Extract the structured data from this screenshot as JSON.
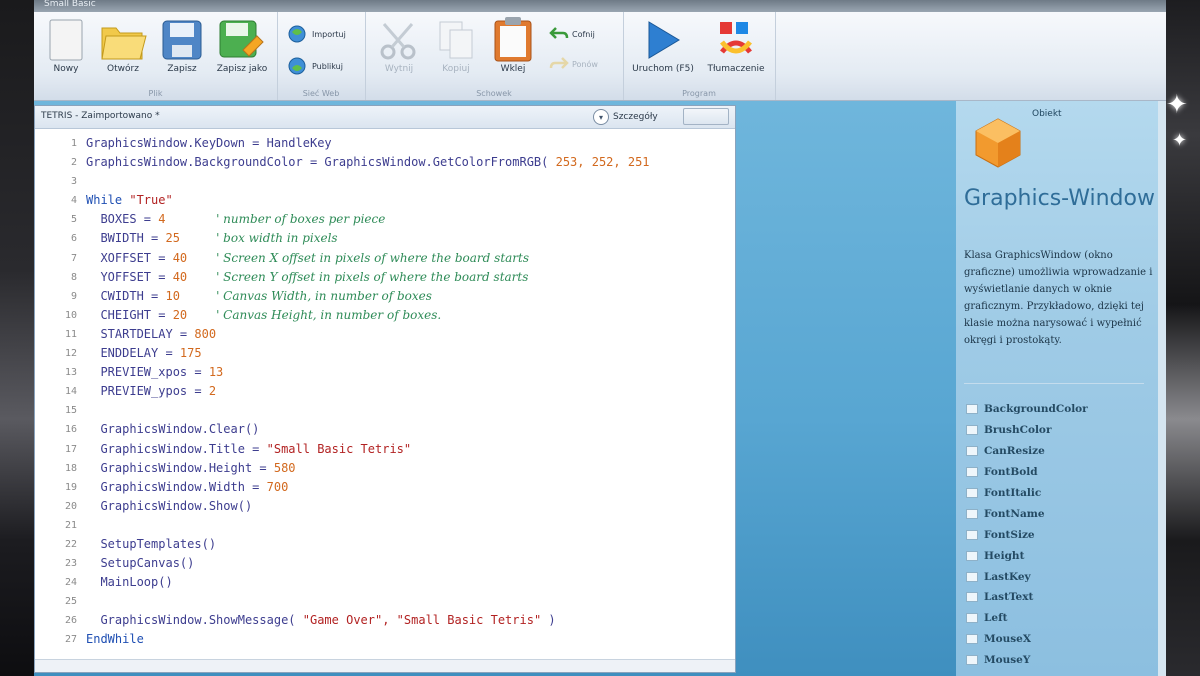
{
  "ribbon": {
    "file_group": {
      "label": "Plik",
      "buttons": [
        {
          "label": "Nowy",
          "icon": "new-file-icon"
        },
        {
          "label": "Otwórz",
          "icon": "open-folder-icon"
        },
        {
          "label": "Zapisz",
          "icon": "save-disk-icon"
        },
        {
          "label": "Zapisz jako",
          "icon": "save-as-icon"
        }
      ]
    },
    "web_group": {
      "label": "Sieć Web",
      "buttons": [
        {
          "label": "Importuj",
          "icon": "import-globe-icon"
        },
        {
          "label": "Publikuj",
          "icon": "publish-globe-icon"
        }
      ]
    },
    "clipboard_group": {
      "label": "Schowek",
      "buttons": [
        {
          "label": "Wytnij",
          "icon": "scissors-icon",
          "enabled": false
        },
        {
          "label": "Kopiuj",
          "icon": "copy-icon",
          "enabled": false
        },
        {
          "label": "Wklej",
          "icon": "clipboard-icon",
          "enabled": true
        },
        {
          "label": "Cofnij",
          "icon": "undo-icon",
          "enabled": true
        },
        {
          "label": "Ponów",
          "icon": "redo-icon",
          "enabled": false
        }
      ]
    },
    "program_group": {
      "label": "Program",
      "buttons": [
        {
          "label": "Uruchom (F5)",
          "icon": "run-play-icon"
        },
        {
          "label": "Tłumaczenie",
          "icon": "translate-icon"
        }
      ]
    }
  },
  "document": {
    "title": "TETRIS - Zaimportowano *",
    "details_label": "Szczegóły"
  },
  "code_lines": [
    {
      "n": "1",
      "parts": [
        {
          "t": "GraphicsWindow.KeyDown = HandleKey",
          "c": "id"
        }
      ]
    },
    {
      "n": "2",
      "parts": [
        {
          "t": "GraphicsWindow.BackgroundColor = GraphicsWindow.GetColorFromRGB( ",
          "c": "id"
        },
        {
          "t": "253, 252, 251",
          "c": "num"
        }
      ]
    },
    {
      "n": "3",
      "parts": []
    },
    {
      "n": "4",
      "parts": [
        {
          "t": "While ",
          "c": "kw"
        },
        {
          "t": "\"True\"",
          "c": "str"
        }
      ]
    },
    {
      "n": "5",
      "parts": [
        {
          "t": "  BOXES = ",
          "c": "id"
        },
        {
          "t": "4",
          "c": "num"
        },
        {
          "t": "       ",
          "c": "id"
        },
        {
          "t": "' number of boxes per piece",
          "c": "cm"
        }
      ]
    },
    {
      "n": "6",
      "parts": [
        {
          "t": "  BWIDTH = ",
          "c": "id"
        },
        {
          "t": "25",
          "c": "num"
        },
        {
          "t": "     ",
          "c": "id"
        },
        {
          "t": "' box width in pixels",
          "c": "cm"
        }
      ]
    },
    {
      "n": "7",
      "parts": [
        {
          "t": "  XOFFSET = ",
          "c": "id"
        },
        {
          "t": "40",
          "c": "num"
        },
        {
          "t": "    ",
          "c": "id"
        },
        {
          "t": "' Screen X offset in pixels of where the board starts",
          "c": "cm"
        }
      ]
    },
    {
      "n": "8",
      "parts": [
        {
          "t": "  YOFFSET = ",
          "c": "id"
        },
        {
          "t": "40",
          "c": "num"
        },
        {
          "t": "    ",
          "c": "id"
        },
        {
          "t": "' Screen Y offset in pixels of where the board starts",
          "c": "cm"
        }
      ]
    },
    {
      "n": "9",
      "parts": [
        {
          "t": "  CWIDTH = ",
          "c": "id"
        },
        {
          "t": "10",
          "c": "num"
        },
        {
          "t": "     ",
          "c": "id"
        },
        {
          "t": "' Canvas Width, in number of boxes",
          "c": "cm"
        }
      ]
    },
    {
      "n": "10",
      "parts": [
        {
          "t": "  CHEIGHT = ",
          "c": "id"
        },
        {
          "t": "20",
          "c": "num"
        },
        {
          "t": "    ",
          "c": "id"
        },
        {
          "t": "' Canvas Height, in number of boxes.",
          "c": "cm"
        }
      ]
    },
    {
      "n": "11",
      "parts": [
        {
          "t": "  STARTDELAY = ",
          "c": "id"
        },
        {
          "t": "800",
          "c": "num"
        }
      ]
    },
    {
      "n": "12",
      "parts": [
        {
          "t": "  ENDDELAY = ",
          "c": "id"
        },
        {
          "t": "175",
          "c": "num"
        }
      ]
    },
    {
      "n": "13",
      "parts": [
        {
          "t": "  PREVIEW_xpos = ",
          "c": "id"
        },
        {
          "t": "13",
          "c": "num"
        }
      ]
    },
    {
      "n": "14",
      "parts": [
        {
          "t": "  PREVIEW_ypos = ",
          "c": "id"
        },
        {
          "t": "2",
          "c": "num"
        }
      ]
    },
    {
      "n": "15",
      "parts": []
    },
    {
      "n": "16",
      "parts": [
        {
          "t": "  GraphicsWindow.Clear()",
          "c": "id"
        }
      ]
    },
    {
      "n": "17",
      "parts": [
        {
          "t": "  GraphicsWindow.Title = ",
          "c": "id"
        },
        {
          "t": "\"Small Basic Tetris\"",
          "c": "str"
        }
      ]
    },
    {
      "n": "18",
      "parts": [
        {
          "t": "  GraphicsWindow.Height = ",
          "c": "id"
        },
        {
          "t": "580",
          "c": "num"
        }
      ]
    },
    {
      "n": "19",
      "parts": [
        {
          "t": "  GraphicsWindow.Width = ",
          "c": "id"
        },
        {
          "t": "700",
          "c": "num"
        }
      ]
    },
    {
      "n": "20",
      "parts": [
        {
          "t": "  GraphicsWindow.Show()",
          "c": "id"
        }
      ]
    },
    {
      "n": "21",
      "parts": []
    },
    {
      "n": "22",
      "parts": [
        {
          "t": "  SetupTemplates()",
          "c": "plain"
        }
      ]
    },
    {
      "n": "23",
      "parts": [
        {
          "t": "  SetupCanvas()",
          "c": "plain"
        }
      ]
    },
    {
      "n": "24",
      "parts": [
        {
          "t": "  MainLoop()",
          "c": "plain"
        }
      ]
    },
    {
      "n": "25",
      "parts": []
    },
    {
      "n": "26",
      "parts": [
        {
          "t": "  GraphicsWindow.ShowMessage( ",
          "c": "id"
        },
        {
          "t": "\"Game Over\", \"Small Basic Tetris\"",
          "c": "str"
        },
        {
          "t": " )",
          "c": "id"
        }
      ]
    },
    {
      "n": "27",
      "parts": [
        {
          "t": "EndWhile",
          "c": "kw"
        }
      ]
    }
  ],
  "help": {
    "kind": "Obiekt",
    "title": "Graphics-Window",
    "description": "Klasa GraphicsWindow (okno graficzne) umożliwia wprowadzanie i wyświetlanie danych w oknie graficznym. Przykładowo, dzięki tej klasie można narysować i wypełnić okręgi i prostokąty.",
    "properties": [
      "BackgroundColor",
      "BrushColor",
      "CanResize",
      "FontBold",
      "FontItalic",
      "FontName",
      "FontSize",
      "Height",
      "LastKey",
      "LastText",
      "Left",
      "MouseX",
      "MouseY"
    ]
  },
  "colors": {
    "accent": "#2f6d98",
    "code_identifier": "#3d3d8f",
    "code_number": "#d2691e",
    "code_string": "#b22222",
    "code_keyword": "#1f4fb3",
    "code_comment": "#2e8b57"
  }
}
